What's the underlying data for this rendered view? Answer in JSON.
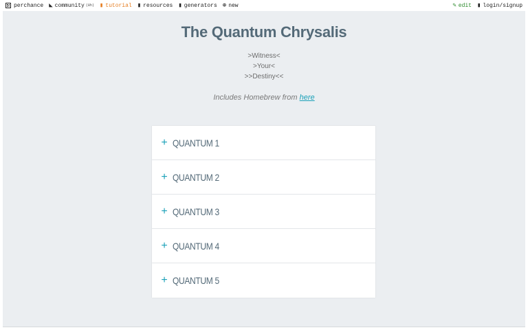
{
  "nav": {
    "site": {
      "label": "perchance",
      "icon": "dice-icon"
    },
    "items": [
      {
        "label": "community",
        "count": "(8h)",
        "icon": "people-icon"
      },
      {
        "label": "tutorial",
        "icon": "book-icon",
        "active": true
      },
      {
        "label": "resources",
        "icon": "folder-icon"
      },
      {
        "label": "generators",
        "icon": "list-icon"
      },
      {
        "label": "new",
        "icon": "plus-circle-icon"
      }
    ],
    "right": [
      {
        "label": "edit",
        "icon": "pencil-icon"
      },
      {
        "label": "login/signup",
        "icon": "user-icon"
      }
    ]
  },
  "page": {
    "title": "The Quantum Chrysalis",
    "intro_lines": [
      ">Witness<",
      ">Your<",
      ">>Destiny<<"
    ],
    "homebrew_text": "Includes Homebrew from ",
    "homebrew_link": "here"
  },
  "accordion": {
    "expand_symbol": "+",
    "items": [
      "QUANTUM 1",
      "QUANTUM 2",
      "QUANTUM 3",
      "QUANTUM 4",
      "QUANTUM 5"
    ]
  },
  "colors": {
    "accent": "#1aa0b8",
    "title": "#546a78",
    "panel_bg": "#ebeef1",
    "active_nav": "#e67e22",
    "edit": "#2e8b2e"
  }
}
